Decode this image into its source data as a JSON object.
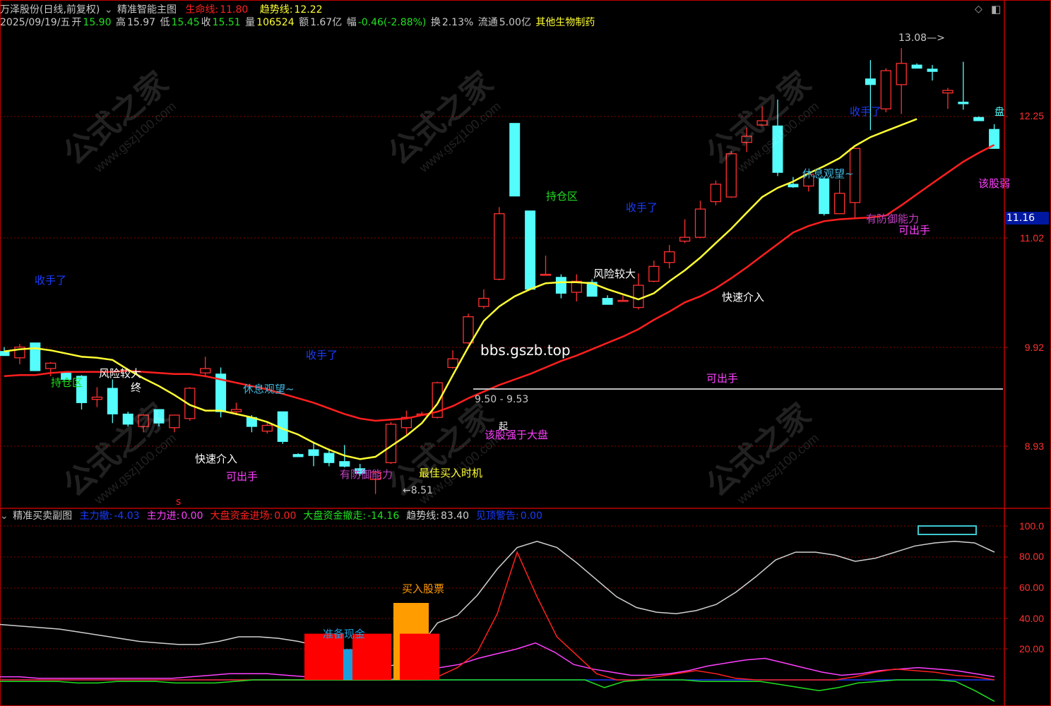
{
  "header": {
    "stock": "万泽股份(日线,前复权)",
    "indicator_name": "精准智能主图",
    "life_line_label": "生命线:",
    "life_line_value": "11.80",
    "trend_line_label": "趋势线:",
    "trend_line_value": "12.22",
    "date": "2025/09/19/五",
    "open_label": "开",
    "open_value": "15.90",
    "high_label": "高",
    "high_value": "15.97",
    "low_label": "低",
    "low_value": "15.45",
    "close_label": "收",
    "close_value": "15.51",
    "volume_label": "量",
    "volume_value": "106524",
    "amount_label": "额",
    "amount_value": "1.67亿",
    "change_label": "幅",
    "change_value": "-0.46(-2.88%)",
    "turnover_label": "换",
    "turnover_value": "2.13%",
    "float_label": "流通",
    "float_value": "5.00亿",
    "sector": "其他生物制药"
  },
  "sub_header": {
    "name": "精准买卖副图",
    "items": [
      {
        "label": "主力撤:",
        "value": "-4.03",
        "color": "#1a3cff"
      },
      {
        "label": "主力进:",
        "value": "0.00",
        "color": "#ff40ff"
      },
      {
        "label": "大盘资金进场:",
        "value": "0.00",
        "color": "#ff2020"
      },
      {
        "label": "大盘资金撤走:",
        "value": "-14.16",
        "color": "#20e020"
      },
      {
        "label": "趋势线:",
        "value": "83.40",
        "color": "#d0d0d0"
      },
      {
        "label": "见顶警告:",
        "value": "0.00",
        "color": "#1a3cff"
      }
    ]
  },
  "price_ticks": [
    "12.25",
    "11.02",
    "9.92",
    "8.93"
  ],
  "highlight_price": "11.16",
  "sub_ticks": [
    "100.0",
    "80.00",
    "60.00",
    "40.00",
    "20.00"
  ],
  "annotations": {
    "max_price": "13.08",
    "min_price": "8.51",
    "range_label": "9.50 - 9.53",
    "website": "bbs.gszb.top",
    "hold_zone_1": "持仓区",
    "hold_zone_2": "持仓区",
    "risk_1": "风险较大",
    "risk_2": "风险较大",
    "end_label": "终",
    "rest_1": "休息观望~",
    "rest_2": "休息观望~",
    "quick_1": "快速介入",
    "quick_2": "快速介入",
    "can_buy_1": "可出手",
    "can_buy_2": "可出手",
    "can_buy_3": "可出手",
    "defense_1": "有防御能力",
    "defense_2": "有防御能力",
    "stop_1": "收手了",
    "stop_2": "收手了",
    "stop_3": "收手了",
    "stop_4": "收手了",
    "best_buy": "最佳买入时机",
    "stronger": "该股强于大盘",
    "weaker": "该股弱",
    "start": "起",
    "s_marker": "s",
    "buy_stock": "买入股票",
    "prepare": "准备现金",
    "right_edge": "盘"
  },
  "watermark": {
    "cn": "公式之家",
    "url": "www.gszj100.com"
  },
  "colors": {
    "up": "#ff3030",
    "down": "#54fcfc",
    "life_line": "#ff1f1f",
    "trend_line": "#ffff33",
    "axis": "#c00000"
  },
  "chart_data": {
    "type": "candlestick",
    "price_axis_ticks": [
      12.25,
      11.02,
      9.92,
      8.93
    ],
    "candles": [
      {
        "o": 9.78,
        "h": 9.82,
        "l": 9.74,
        "c": 9.74
      },
      {
        "o": 9.72,
        "h": 9.85,
        "l": 9.66,
        "c": 9.82
      },
      {
        "o": 9.86,
        "h": 9.86,
        "l": 9.6,
        "c": 9.6
      },
      {
        "o": 9.62,
        "h": 9.68,
        "l": 9.55,
        "c": 9.67
      },
      {
        "o": 9.58,
        "h": 9.59,
        "l": 9.52,
        "c": 9.52
      },
      {
        "o": 9.55,
        "h": 9.56,
        "l": 9.25,
        "c": 9.31
      },
      {
        "o": 9.34,
        "h": 9.45,
        "l": 9.27,
        "c": 9.36
      },
      {
        "o": 9.44,
        "h": 9.52,
        "l": 9.13,
        "c": 9.21
      },
      {
        "o": 9.21,
        "h": 9.23,
        "l": 9.1,
        "c": 9.12
      },
      {
        "o": 9.1,
        "h": 9.21,
        "l": 9.05,
        "c": 9.2
      },
      {
        "o": 9.25,
        "h": 9.25,
        "l": 9.1,
        "c": 9.13
      },
      {
        "o": 9.09,
        "h": 9.2,
        "l": 9.05,
        "c": 9.2
      },
      {
        "o": 9.17,
        "h": 9.45,
        "l": 9.15,
        "c": 9.44
      },
      {
        "o": 9.58,
        "h": 9.73,
        "l": 9.54,
        "c": 9.62
      },
      {
        "o": 9.57,
        "h": 9.63,
        "l": 9.18,
        "c": 9.23
      },
      {
        "o": 9.23,
        "h": 9.31,
        "l": 9.2,
        "c": 9.25
      },
      {
        "o": 9.18,
        "h": 9.2,
        "l": 9.05,
        "c": 9.1
      },
      {
        "o": 9.06,
        "h": 9.13,
        "l": 9.04,
        "c": 9.11
      },
      {
        "o": 9.23,
        "h": 9.23,
        "l": 8.95,
        "c": 8.97
      },
      {
        "o": 8.86,
        "h": 8.87,
        "l": 8.84,
        "c": 8.84
      },
      {
        "o": 8.9,
        "h": 8.97,
        "l": 8.76,
        "c": 8.85
      },
      {
        "o": 8.87,
        "h": 8.91,
        "l": 8.76,
        "c": 8.79
      },
      {
        "o": 8.8,
        "h": 8.94,
        "l": 8.75,
        "c": 8.76
      },
      {
        "o": 8.74,
        "h": 8.78,
        "l": 8.68,
        "c": 8.7
      },
      {
        "o": 8.65,
        "h": 8.72,
        "l": 8.53,
        "c": 8.71
      },
      {
        "o": 8.79,
        "h": 9.14,
        "l": 8.78,
        "c": 9.12
      },
      {
        "o": 9.09,
        "h": 9.24,
        "l": 9.03,
        "c": 9.18
      },
      {
        "o": 9.21,
        "h": 9.23,
        "l": 9.2,
        "c": 9.21
      },
      {
        "o": 9.18,
        "h": 9.5,
        "l": 9.17,
        "c": 9.49
      },
      {
        "o": 9.63,
        "h": 9.79,
        "l": 9.62,
        "c": 9.71
      },
      {
        "o": 9.86,
        "h": 10.14,
        "l": 9.85,
        "c": 10.11
      },
      {
        "o": 10.21,
        "h": 10.38,
        "l": 10.19,
        "c": 10.29
      },
      {
        "o": 10.48,
        "h": 11.23,
        "l": 10.47,
        "c": 11.16
      },
      {
        "o": 12.17,
        "h": 12.17,
        "l": 11.35,
        "c": 11.35
      },
      {
        "o": 11.19,
        "h": 11.19,
        "l": 10.38,
        "c": 10.38
      },
      {
        "o": 10.53,
        "h": 10.72,
        "l": 10.52,
        "c": 10.53
      },
      {
        "o": 10.5,
        "h": 10.53,
        "l": 10.29,
        "c": 10.34
      },
      {
        "o": 10.35,
        "h": 10.53,
        "l": 10.26,
        "c": 10.46
      },
      {
        "o": 10.45,
        "h": 10.48,
        "l": 10.31,
        "c": 10.31
      },
      {
        "o": 10.29,
        "h": 10.32,
        "l": 10.23,
        "c": 10.23
      },
      {
        "o": 10.27,
        "h": 10.32,
        "l": 10.26,
        "c": 10.27
      },
      {
        "o": 10.2,
        "h": 10.54,
        "l": 10.18,
        "c": 10.42
      },
      {
        "o": 10.46,
        "h": 10.67,
        "l": 10.45,
        "c": 10.61
      },
      {
        "o": 10.65,
        "h": 10.83,
        "l": 10.59,
        "c": 10.76
      },
      {
        "o": 10.87,
        "h": 11.1,
        "l": 10.85,
        "c": 10.91
      },
      {
        "o": 10.91,
        "h": 11.3,
        "l": 10.9,
        "c": 11.21
      },
      {
        "o": 11.29,
        "h": 11.52,
        "l": 11.25,
        "c": 11.48
      },
      {
        "o": 11.34,
        "h": 11.85,
        "l": 11.33,
        "c": 11.82
      },
      {
        "o": 11.95,
        "h": 12.12,
        "l": 11.84,
        "c": 12.02
      },
      {
        "o": 12.15,
        "h": 12.37,
        "l": 12.14,
        "c": 12.2
      },
      {
        "o": 12.14,
        "h": 12.45,
        "l": 11.57,
        "c": 11.61
      },
      {
        "o": 11.48,
        "h": 11.56,
        "l": 11.44,
        "c": 11.45
      },
      {
        "o": 11.46,
        "h": 11.6,
        "l": 11.4,
        "c": 11.59
      },
      {
        "o": 11.54,
        "h": 11.56,
        "l": 11.14,
        "c": 11.16
      },
      {
        "o": 11.16,
        "h": 11.53,
        "l": 11.16,
        "c": 11.38
      },
      {
        "o": 11.28,
        "h": 11.88,
        "l": 11.12,
        "c": 11.88
      },
      {
        "o": 12.7,
        "h": 12.93,
        "l": 12.09,
        "c": 12.63
      },
      {
        "o": 12.34,
        "h": 12.83,
        "l": 12.3,
        "c": 12.8
      },
      {
        "o": 12.63,
        "h": 13.08,
        "l": 12.28,
        "c": 12.89
      },
      {
        "o": 12.87,
        "h": 12.89,
        "l": 12.83,
        "c": 12.83
      },
      {
        "o": 12.82,
        "h": 12.87,
        "l": 12.68,
        "c": 12.79
      },
      {
        "o": 12.53,
        "h": 12.59,
        "l": 12.34,
        "c": 12.56
      },
      {
        "o": 12.42,
        "h": 12.91,
        "l": 12.33,
        "c": 12.4
      },
      {
        "o": 12.24,
        "h": 12.25,
        "l": 12.2,
        "c": 12.2
      },
      {
        "o": 12.1,
        "h": 12.16,
        "l": 11.88,
        "c": 11.88
      }
    ],
    "life_line": [
      9.55,
      9.56,
      9.56,
      9.58,
      9.59,
      9.59,
      9.59,
      9.59,
      9.6,
      9.59,
      9.58,
      9.57,
      9.57,
      9.55,
      9.52,
      9.49,
      9.46,
      9.43,
      9.39,
      9.35,
      9.31,
      9.26,
      9.21,
      9.17,
      9.15,
      9.16,
      9.17,
      9.2,
      9.23,
      9.28,
      9.35,
      9.41,
      9.47,
      9.52,
      9.57,
      9.63,
      9.69,
      9.74,
      9.8,
      9.86,
      9.92,
      9.99,
      10.08,
      10.16,
      10.25,
      10.31,
      10.39,
      10.49,
      10.6,
      10.72,
      10.84,
      10.96,
      11.03,
      11.08,
      11.1,
      11.11,
      11.12,
      11.14,
      11.25,
      11.37,
      11.49,
      11.61,
      11.73,
      11.83,
      11.92
    ],
    "trend_line": [
      9.78,
      9.8,
      9.81,
      9.79,
      9.76,
      9.73,
      9.72,
      9.7,
      9.61,
      9.53,
      9.46,
      9.38,
      9.29,
      9.24,
      9.24,
      9.21,
      9.18,
      9.14,
      9.08,
      9.03,
      8.96,
      8.9,
      8.85,
      8.82,
      8.84,
      8.93,
      9.02,
      9.13,
      9.3,
      9.56,
      9.82,
      10.07,
      10.21,
      10.31,
      10.38,
      10.44,
      10.45,
      10.45,
      10.44,
      10.38,
      10.33,
      10.28,
      10.34,
      10.46,
      10.57,
      10.7,
      10.85,
      11.0,
      11.17,
      11.34,
      11.44,
      11.51,
      11.6,
      11.68,
      11.77,
      11.91,
      12.01,
      12.08,
      12.15,
      12.22
    ],
    "sub_axis_ticks": [
      100,
      80,
      60,
      40,
      20
    ],
    "sub_trend_line": [
      36,
      35,
      34,
      33,
      31,
      29,
      27,
      25,
      24,
      23,
      23,
      25,
      28,
      28,
      27,
      25,
      22,
      17,
      12,
      8,
      10,
      20,
      37,
      42,
      55,
      72,
      86,
      90,
      86,
      76,
      65,
      54,
      47,
      44,
      43,
      45,
      49,
      57,
      67,
      78,
      83,
      83,
      81,
      77,
      79,
      83,
      87,
      89,
      90,
      89,
      83
    ],
    "main_force_in": [
      2,
      2,
      1,
      1,
      1,
      1,
      1,
      1,
      1,
      1,
      2,
      3,
      4,
      4,
      4,
      3,
      2,
      1,
      0,
      0,
      0,
      1,
      3,
      8,
      10,
      14,
      17,
      20,
      24,
      18,
      10,
      7,
      5,
      3,
      3,
      4,
      6,
      9,
      11,
      13,
      14,
      11,
      8,
      5,
      3,
      4,
      6,
      7,
      8,
      7,
      6,
      4,
      2
    ],
    "market_in": [
      0,
      0,
      0,
      0,
      0,
      0,
      0,
      0,
      0,
      0,
      0,
      0,
      0,
      0,
      0,
      0,
      0,
      0,
      0,
      0,
      0,
      0,
      2,
      8,
      18,
      43,
      83,
      54,
      28,
      16,
      4,
      0,
      0,
      2,
      4,
      6,
      4,
      1,
      0,
      0,
      0,
      0,
      0,
      2,
      5,
      7,
      6,
      5,
      3,
      2,
      0
    ],
    "market_out": [
      -1,
      -1,
      -1,
      -1,
      -2,
      -2,
      -1,
      -1,
      -1,
      -2,
      -2,
      -2,
      -1,
      0,
      0,
      0,
      0,
      0,
      0,
      0,
      0,
      0,
      0,
      0,
      0,
      0,
      0,
      0,
      0,
      0,
      0,
      -5,
      -1,
      0,
      0,
      0,
      -1,
      -1,
      -1,
      -1,
      -3,
      -5,
      -7,
      -5,
      -2,
      -1,
      0,
      0,
      0,
      -1,
      -7,
      -14
    ],
    "bars": [
      {
        "label": "准备现金",
        "value": 30,
        "color": "#ff0000"
      },
      {
        "label": "",
        "value": 20,
        "color": "#1a9edc"
      },
      {
        "label": "",
        "value": 30,
        "color": "#ff0000"
      },
      {
        "label": "买入股票",
        "value": 50,
        "color": "#ff9d00"
      },
      {
        "label": "",
        "value": 30,
        "color": "#ff0000"
      }
    ]
  }
}
